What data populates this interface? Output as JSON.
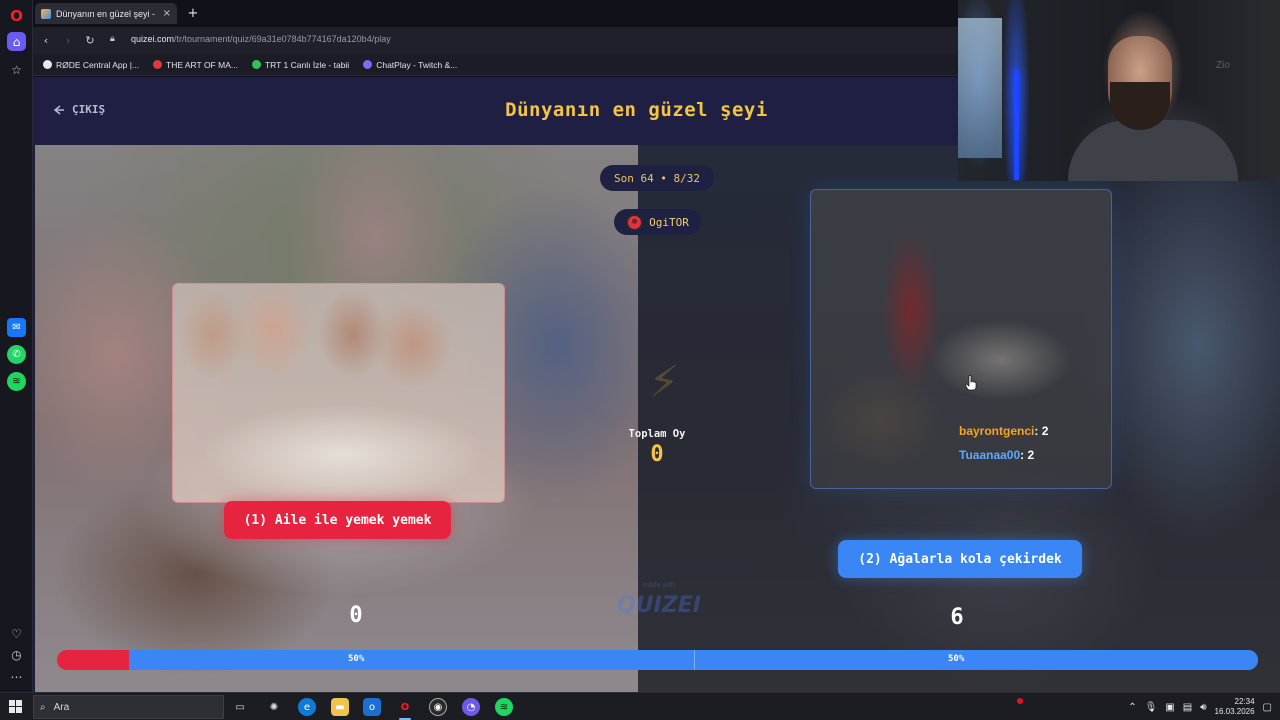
{
  "browser": {
    "tab_title": "Dünyanın en güzel şeyi -",
    "url_host": "quizei.com",
    "url_path": "/tr/tournament/quiz/69a31e0784b774167da120b4/play",
    "bookmarks": [
      {
        "label": "RØDE Central App |...",
        "color": "#e8e8ee"
      },
      {
        "label": "THE ART OF MA...",
        "color": "#e23a3a"
      },
      {
        "label": "TRT 1 Canlı İzle - tabii",
        "color": "#2fc35a"
      },
      {
        "label": "ChatPlay - Twitch &...",
        "color": "#7b6cff"
      }
    ]
  },
  "quiz": {
    "exit_label": "ÇIKIŞ",
    "title": "Dünyanın en güzel şeyi",
    "round": "Son 64 • 8/32",
    "username": "OgiTOR",
    "total_label": "Toplam Oy",
    "total_value": "0",
    "option1": {
      "label": "(1) Aile ile yemek yemek",
      "count": "0",
      "percent_label": "50%",
      "bar_fraction": 0.06
    },
    "option2": {
      "label": "(2) Ağalarla kola çekirdek",
      "count": "6",
      "percent_label": "50%"
    },
    "voters": [
      {
        "name": "bayrontgenci",
        "score": ": 2"
      },
      {
        "name": "Tuaanaa00",
        "score": ": 2"
      }
    ],
    "made_with": "made with",
    "brand": "QUIZEI",
    "colors": {
      "accent": "#f5c542",
      "option1": "#e7243f",
      "option2": "#3a86f5"
    }
  },
  "webcam": {
    "overlay_text": "Zio"
  },
  "taskbar": {
    "search_placeholder": "Ara",
    "time": "22:34",
    "date": "16.03.2026"
  }
}
